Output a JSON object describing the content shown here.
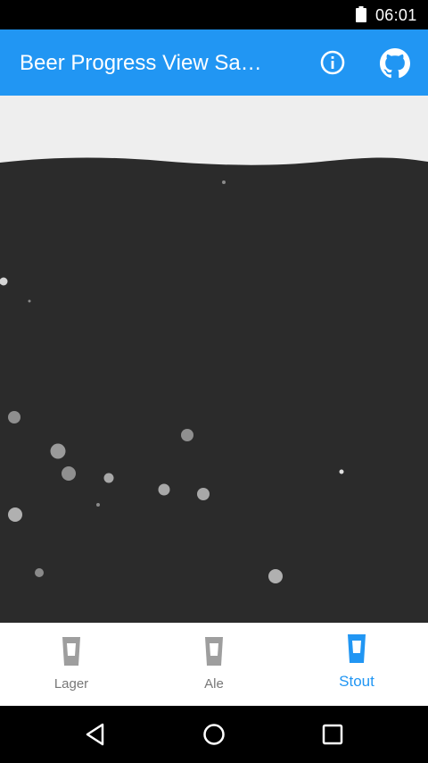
{
  "status_bar": {
    "time": "06:01",
    "icons": [
      "battery-icon"
    ]
  },
  "app_bar": {
    "title": "Beer Progress View Sa…",
    "actions": [
      "info-icon",
      "github-icon"
    ],
    "color": "#2196F3"
  },
  "beer_view": {
    "selected_type": "Stout",
    "fill_level": 0.87,
    "liquid_color": "#2b2b2b",
    "empty_color": "#eeeeee",
    "bubble_color": "#9e9e9e"
  },
  "bottom_nav": {
    "items": [
      {
        "label": "Lager",
        "icon": "beer-glass-icon",
        "active": false
      },
      {
        "label": "Ale",
        "icon": "beer-glass-icon",
        "active": false
      },
      {
        "label": "Stout",
        "icon": "beer-glass-icon",
        "active": true
      }
    ],
    "active_color": "#2196F3",
    "inactive_color": "#9e9e9e"
  },
  "system_nav": {
    "buttons": [
      "back-icon",
      "home-icon",
      "recents-icon"
    ]
  }
}
